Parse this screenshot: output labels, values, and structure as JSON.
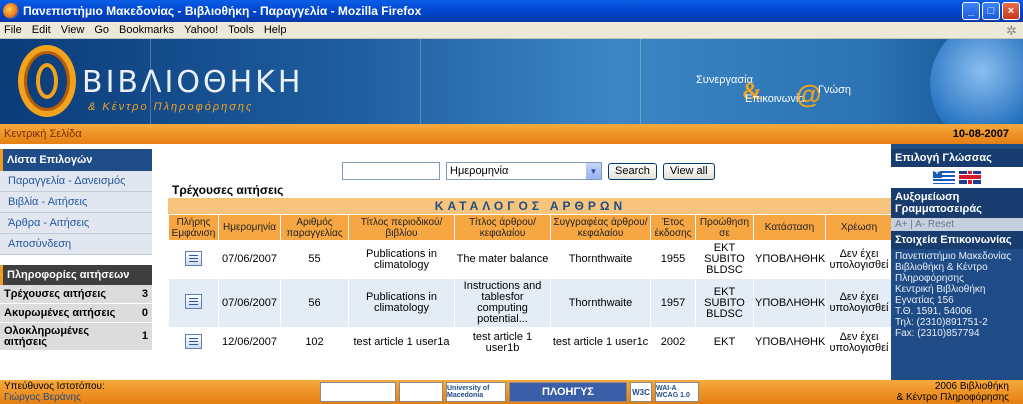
{
  "window": {
    "title": "Πανεπιστήμιο Μακεδονίας - Βιβλιοθήκη - Παραγγελία - Mozilla Firefox",
    "buttons": [
      "_",
      "□",
      "×"
    ]
  },
  "menubar": {
    "items": [
      "File",
      "Edit",
      "View",
      "Go",
      "Bookmarks",
      "Yahoo!",
      "Tools",
      "Help"
    ]
  },
  "banner": {
    "title": "ΒΙΒΛΙΟΘΗΚΗ",
    "subtitle": "& Κέντρο Πληροφόρησης",
    "slogan1": "Συνεργασία",
    "amp": "&",
    "slogan2": "Επικοινωνία",
    "at": "@",
    "slogan3": "Γνώση"
  },
  "nav": {
    "home": "Κεντρική Σελίδα",
    "date": "10-08-2007"
  },
  "left": {
    "menu_title": "Λίστα Επιλογών",
    "menu_items": [
      "Παραγγελία - Δανεισμός",
      "Βιβλία - Αιτήσεις",
      "Άρθρα - Αιτήσεις",
      "Αποσύνδεση"
    ],
    "stats_title": "Πληροφορίες αιτήσεων",
    "stats": [
      {
        "label": "Τρέχουσες αιτήσεις",
        "count": "3"
      },
      {
        "label": "Ακυρωμένες αιτήσεις",
        "count": "0"
      },
      {
        "label": "Ολοκληρωμένες αιτήσεις",
        "count": "1"
      }
    ]
  },
  "right": {
    "lang_title": "Επιλογή Γλώσσας",
    "font_title": "Αυξομείωση Γραμματοσειράς",
    "font_controls": "A+ | A- Reset",
    "contact_title": "Στοιχεία Επικοινωνίας",
    "contact_lines": [
      "Πανεπιστήμιο Μακεδονίας",
      "Βιβλιοθήκη & Κέντρο",
      "Πληροφόρησης",
      "Κεντρική Βιβλιοθήκη",
      "Εγνατίας 156",
      "Τ.Θ. 1591, 54006",
      "Τηλ: (2310)891751-2",
      "Fax: (2310)857794"
    ]
  },
  "search": {
    "value": "",
    "field_select": "Ημερομηνία",
    "search_btn": "Search",
    "viewall_btn": "View all"
  },
  "main": {
    "section_title": "Τρέχουσες αιτήσεις",
    "table_caption": "ΚΑΤΑΛΟΓΟΣ ΑΡΘΡΩΝ",
    "headers": [
      "Πλήρης Εμφάνιση",
      "Ημερομηνία",
      "Αριθμός παραγγελίας",
      "Τίτλος περιοδικού/βιβλίου",
      "Τίτλος άρθρου/κεφαλαίου",
      "Συγγραφέας άρθρου/κεφαλαίου",
      "Έτος έκδοσης",
      "Προώθηση σε",
      "Κατάσταση",
      "Χρέωση"
    ],
    "rows": [
      {
        "date": "07/06/2007",
        "order": "55",
        "journal": "Publications in climatology",
        "article": "The mater balance",
        "author": "Thornthwaite",
        "year": "1955",
        "forward": "EKT SUBITO BLDSC",
        "status": "ΥΠΟΒΛΗΘΗΚΕ",
        "charge": "Δεν έχει υπολογισθεί"
      },
      {
        "date": "07/06/2007",
        "order": "56",
        "journal": "Publications in climatology",
        "article": "Instructions and tablesfor computing potential...",
        "author": "Thornthwaite",
        "year": "1957",
        "forward": "EKT SUBITO BLDSC",
        "status": "ΥΠΟΒΛΗΘΗΚΕ",
        "charge": "Δεν έχει υπολογισθεί"
      },
      {
        "date": "12/06/2007",
        "order": "102",
        "journal": "test article 1 user1a",
        "article": "test article 1 user1b",
        "author": "test article 1 user1c",
        "year": "2002",
        "forward": "EKT",
        "status": "ΥΠΟΒΛΗΘΗΚΕ",
        "charge": "Δεν έχει υπολογισθεί"
      }
    ]
  },
  "footer": {
    "webmaster_label": "Υπεύθυνος Ιστοτόπου:",
    "webmaster_name": "Γιώργος Βεράνης",
    "logos": [
      "",
      "",
      "University of Macedonia",
      "ΠΛΟΗΓΥΣ",
      "W3C",
      "WAI-A WCAG 1.0"
    ],
    "copyright1": "2006 Βιβλιοθήκη",
    "copyright2": "& Κέντρο Πληροφόρησης"
  }
}
